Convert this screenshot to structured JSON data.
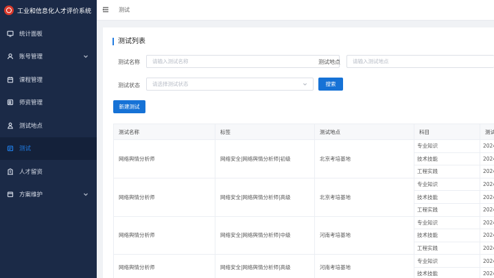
{
  "app": {
    "title": "工业和信息化人才评价系统"
  },
  "sidebar": {
    "items": [
      {
        "label": "统计面板",
        "icon": "monitor-icon",
        "active": false,
        "expandable": false
      },
      {
        "label": "账号管理",
        "icon": "user-icon",
        "active": false,
        "expandable": true
      },
      {
        "label": "课程管理",
        "icon": "calendar-icon",
        "active": false,
        "expandable": false
      },
      {
        "label": "师资管理",
        "icon": "teacher-icon",
        "active": false,
        "expandable": false
      },
      {
        "label": "测试地点",
        "icon": "person-icon",
        "active": false,
        "expandable": false
      },
      {
        "label": "测试",
        "icon": "exam-icon",
        "active": true,
        "expandable": false
      },
      {
        "label": "人才留资",
        "icon": "building-icon",
        "active": false,
        "expandable": false
      },
      {
        "label": "方案维护",
        "icon": "box-icon",
        "active": false,
        "expandable": true
      }
    ]
  },
  "header": {
    "breadcrumb": "测试"
  },
  "main": {
    "title": "测试列表",
    "filters": {
      "name_label": "测试名称",
      "name_placeholder": "请输入测试名称",
      "location_label": "测试地点",
      "location_placeholder": "请输入测试地点",
      "status_label": "测试状态",
      "status_placeholder": "请选择测试状态",
      "search_button": "搜索"
    },
    "new_button": "新建测试",
    "table": {
      "columns": [
        "测试名称",
        "标签",
        "测试地点",
        "科目",
        "测试"
      ],
      "rows": [
        {
          "name": "网络舆情分析师",
          "tag": "网络安全|网络舆情分析师|初级",
          "location": "北京考培基地",
          "subjects": [
            "专业知识",
            "技术技能",
            "工程实践"
          ],
          "dates": [
            "2024",
            "2024",
            "2024"
          ]
        },
        {
          "name": "网络舆情分析师",
          "tag": "网络安全|网络舆情分析师|高级",
          "location": "北京考培基地",
          "subjects": [
            "专业知识",
            "技术技能",
            "工程实践"
          ],
          "dates": [
            "2024",
            "2024",
            "2024"
          ]
        },
        {
          "name": "网络舆情分析师",
          "tag": "网络安全|网络舆情分析师|中级",
          "location": "河南考培基地",
          "subjects": [
            "专业知识",
            "技术技能",
            "工程实践"
          ],
          "dates": [
            "2024",
            "2024",
            "2024"
          ]
        },
        {
          "name": "网络舆情分析师",
          "tag": "网络安全|网络舆情分析师|高级",
          "location": "河南考培基地",
          "subjects": [
            "专业知识",
            "技术技能"
          ],
          "dates": [
            "2024",
            "2024"
          ]
        }
      ]
    }
  },
  "colors": {
    "sidebar_bg": "#1b2a47",
    "accent": "#1f7ae0",
    "button": "#1672d6",
    "logo": "#d9392b"
  }
}
